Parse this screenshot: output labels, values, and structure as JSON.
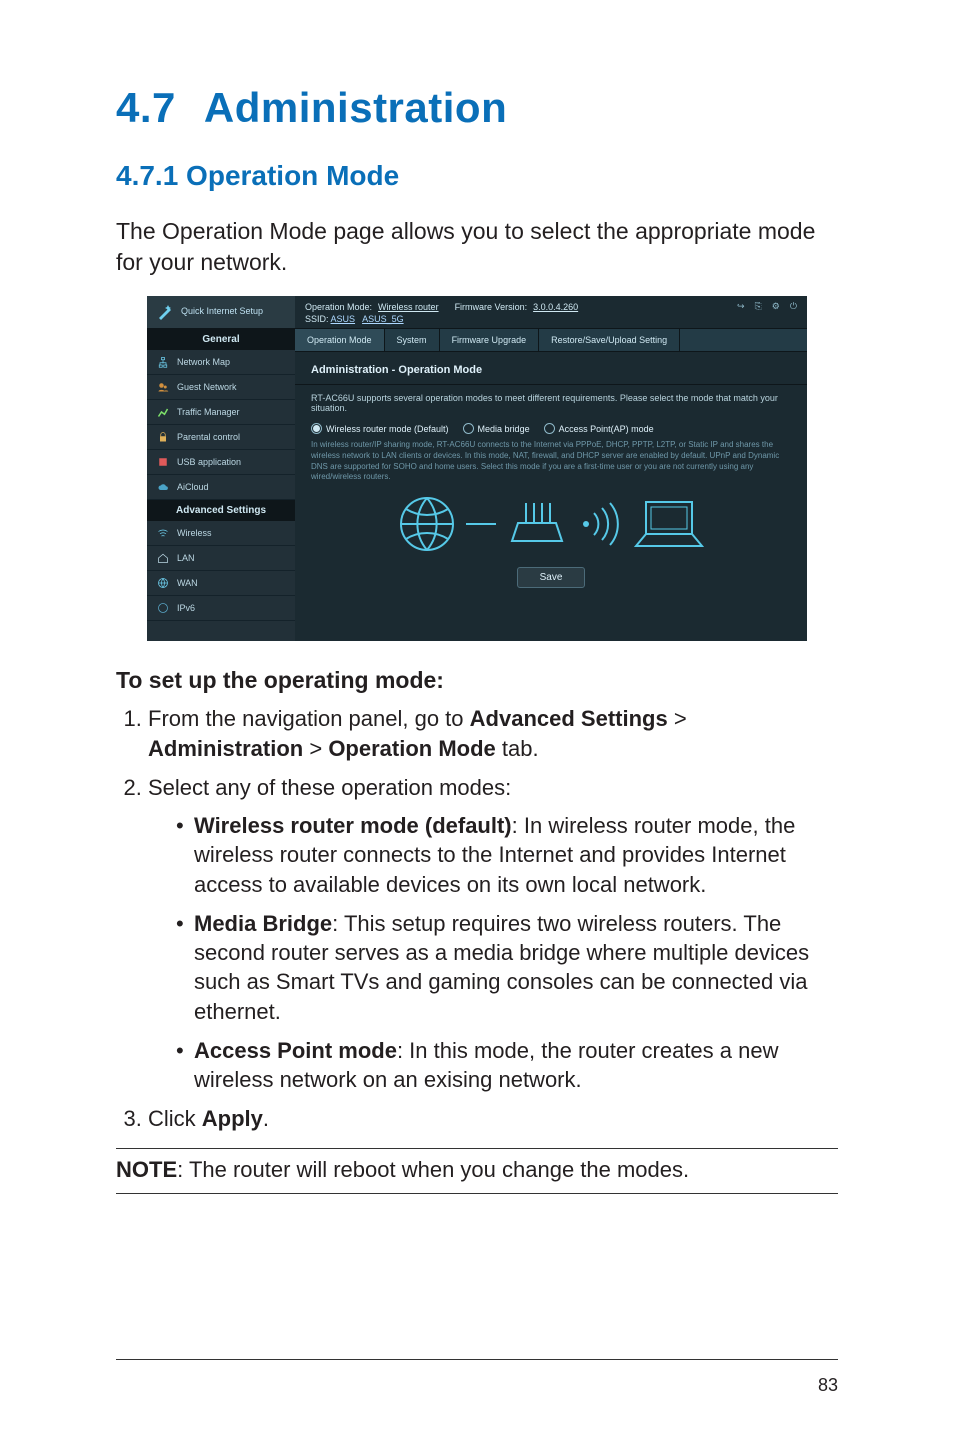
{
  "page_number": "83",
  "h1_num": "4.7",
  "h1_title": "Administration",
  "h2": "4.7.1 Operation Mode",
  "intro": "The Operation Mode page allows you to select the appropriate mode for your network.",
  "shot": {
    "qis": "Quick Internet Setup",
    "general_head": "General",
    "advanced_head": "Advanced Settings",
    "general_items": [
      "Network Map",
      "Guest Network",
      "Traffic Manager",
      "Parental control",
      "USB application",
      "AiCloud"
    ],
    "advanced_items": [
      "Wireless",
      "LAN",
      "WAN",
      "IPv6"
    ],
    "topbar_mode_label": "Operation Mode:",
    "topbar_mode_value": "Wireless router",
    "topbar_fw_label": "Firmware Version:",
    "topbar_fw_value": "3.0.0.4.260",
    "ssid_label": "SSID:",
    "ssid1": "ASUS",
    "ssid2": "ASUS_5G",
    "tabs": [
      "Operation Mode",
      "System",
      "Firmware Upgrade",
      "Restore/Save/Upload Setting"
    ],
    "content_title": "Administration - Operation Mode",
    "content_desc": "RT-AC66U supports several operation modes to meet different requirements. Please select the mode that match your situation.",
    "radio1": "Wireless router mode (Default)",
    "radio2": "Media bridge",
    "radio3": "Access Point(AP) mode",
    "smalltxt": "In wireless router/IP sharing mode, RT-AC66U connects to the Internet via PPPoE, DHCP, PPTP, L2TP, or Static IP and shares the wireless network to LAN clients or devices. In this mode, NAT, firewall, and DHCP server are enabled by default. UPnP and Dynamic DNS are supported for SOHO and home users. Select this mode if you are a first-time user or you are not currently using any wired/wireless routers.",
    "save": "Save"
  },
  "setup_lead": "To set up the operating mode:",
  "step1a": "From the navigation panel, go to ",
  "step1b": "Advanced Settings",
  "step1c": " > ",
  "step1d": "Administration",
  "step1e": " > ",
  "step1f": "Operation Mode",
  "step1g": " tab.",
  "step2": "Select any of these operation modes:",
  "mode1_b": "Wireless router mode (default)",
  "mode1_t": ": In wireless router mode, the wireless router connects to the Internet and provides Internet access to available devices on its own local network.",
  "mode2_b": "Media Bridge",
  "mode2_t": ": This setup requires two wireless routers. The second router serves as a media bridge where multiple devices such as Smart TVs and gaming consoles can be connected via ethernet.",
  "mode3_b": "Access Point mode",
  "mode3_t": ": In this mode, the router creates a new wireless network on an exising network.",
  "step3a": "Click ",
  "step3b": "Apply",
  "step3c": ".",
  "note_b": "NOTE",
  "note_t": ":  The router will reboot when you change the modes."
}
